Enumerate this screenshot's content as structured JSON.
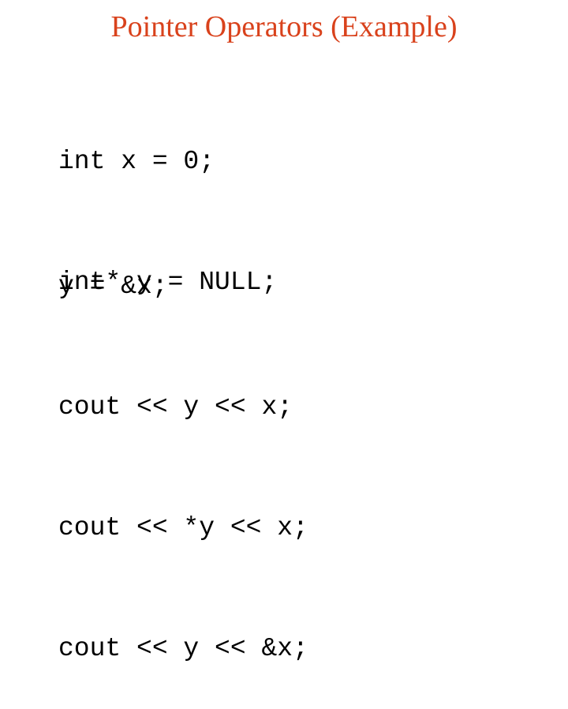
{
  "slide": {
    "title": "Pointer Operators (Example)",
    "title_color": "#d9421c",
    "code_block_1": [
      "int x = 0;",
      "int* y = NULL;"
    ],
    "code_block_2": [
      "y = &x;",
      "cout << y << x;",
      "cout << *y << x;",
      "cout << y << &x;"
    ]
  }
}
